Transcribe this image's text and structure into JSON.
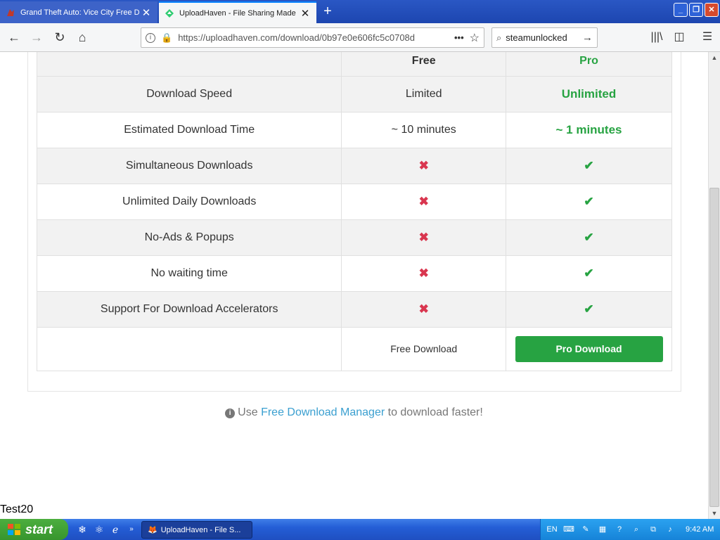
{
  "browser": {
    "tabs": [
      {
        "title": "Grand Theft Auto: Vice City Free D",
        "active": false
      },
      {
        "title": "UploadHaven - File Sharing Made",
        "active": true
      }
    ],
    "url": "https://uploadhaven.com/download/0b97e0e606fc5c0708d",
    "search_value": "steamunlocked"
  },
  "table": {
    "headers": {
      "free": "Free",
      "pro": "Pro"
    },
    "rows": [
      {
        "feature": "Download Speed",
        "free": "Limited",
        "pro": "Unlimited",
        "free_type": "text",
        "pro_type": "value"
      },
      {
        "feature": "Estimated Download Time",
        "free": "~ 10 minutes",
        "pro": "~ 1 minutes",
        "free_type": "text",
        "pro_type": "value"
      },
      {
        "feature": "Simultaneous Downloads",
        "free": "✖",
        "pro": "✔",
        "free_type": "cross",
        "pro_type": "check"
      },
      {
        "feature": "Unlimited Daily Downloads",
        "free": "✖",
        "pro": "✔",
        "free_type": "cross",
        "pro_type": "check"
      },
      {
        "feature": "No-Ads & Popups",
        "free": "✖",
        "pro": "✔",
        "free_type": "cross",
        "pro_type": "check"
      },
      {
        "feature": "No waiting time",
        "free": "✖",
        "pro": "✔",
        "free_type": "cross",
        "pro_type": "check"
      },
      {
        "feature": "Support For Download Accelerators",
        "free": "✖",
        "pro": "✔",
        "free_type": "cross",
        "pro_type": "check"
      }
    ],
    "free_download_label": "Free Download",
    "pro_download_label": "Pro Download"
  },
  "fdm_note": {
    "prefix": "Use ",
    "link": "Free Download Manager",
    "suffix": " to download faster!"
  },
  "test_label": "Test20",
  "taskbar": {
    "start_label": "start",
    "task_item": "UploadHaven - File S...",
    "language": "EN",
    "clock": "9:42 AM"
  },
  "colors": {
    "pro_green": "#27a342",
    "cross_red": "#d9364f",
    "link_blue": "#3a9fd0"
  }
}
